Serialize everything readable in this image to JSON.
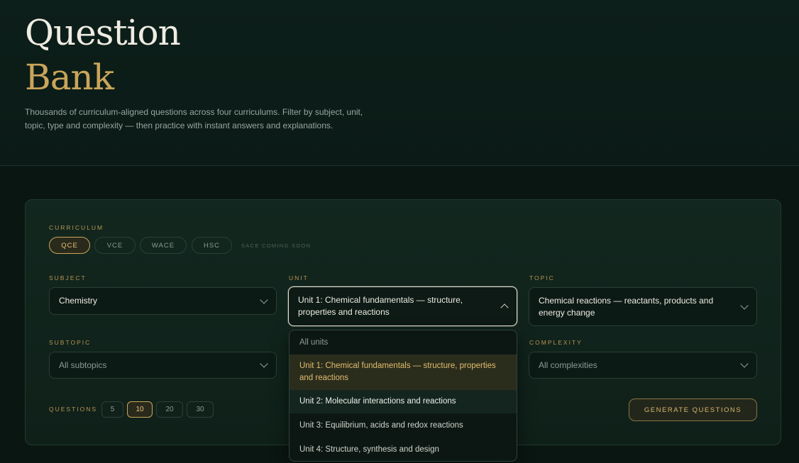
{
  "hero": {
    "title_line1": "Question",
    "title_line2": "Bank",
    "subtitle": "Thousands of curriculum-aligned questions across four curriculums. Filter by subject, unit, topic, type and complexity — then practice with instant answers and explanations."
  },
  "curriculum": {
    "label": "CURRICULUM",
    "options": [
      "QCE",
      "VCE",
      "WACE",
      "HSC"
    ],
    "selected": "QCE",
    "note": "SACE COMING SOON"
  },
  "subject": {
    "label": "SUBJECT",
    "value": "Chemistry"
  },
  "unit": {
    "label": "UNIT",
    "value": "Unit 1: Chemical fundamentals — structure, properties and reactions",
    "options": [
      "All units",
      "Unit 1: Chemical fundamentals — structure, properties and reactions",
      "Unit 2: Molecular interactions and reactions",
      "Unit 3: Equilibrium, acids and redox reactions",
      "Unit 4: Structure, synthesis and design"
    ]
  },
  "topic": {
    "label": "TOPIC",
    "value": "Chemical reactions — reactants, products and energy change"
  },
  "subtopic": {
    "label": "SUBTOPIC",
    "value": "All subtopics"
  },
  "complexity": {
    "label": "COMPLEXITY",
    "value": "All complexities"
  },
  "questions": {
    "label": "QUESTIONS",
    "options": [
      "5",
      "10",
      "20",
      "30"
    ],
    "selected": "10"
  },
  "generate_label": "GENERATE QUESTIONS",
  "colors": {
    "background": "#0a1612",
    "accent_gold": "#c9a55a",
    "panel": "#12271f"
  },
  "icons": [
    "chevron-down-icon",
    "chevron-up-icon"
  ]
}
